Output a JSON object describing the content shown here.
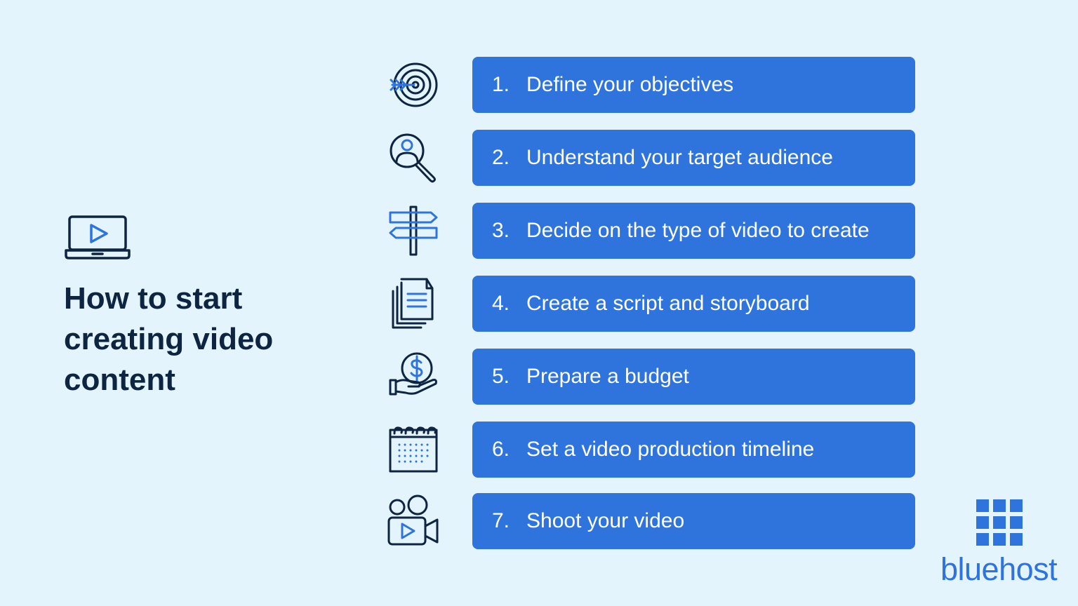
{
  "title_lines": [
    "How to start",
    "creating video",
    "content"
  ],
  "steps": [
    {
      "number": "1.",
      "label": "Define your objectives",
      "icon": "target-icon"
    },
    {
      "number": "2.",
      "label": "Understand your target audience",
      "icon": "audience-search-icon"
    },
    {
      "number": "3.",
      "label": "Decide on the type of video to create",
      "icon": "signpost-icon"
    },
    {
      "number": "4.",
      "label": "Create a script and storyboard",
      "icon": "documents-icon"
    },
    {
      "number": "5.",
      "label": "Prepare a budget",
      "icon": "budget-hand-icon"
    },
    {
      "number": "6.",
      "label": "Set a video production timeline",
      "icon": "calendar-icon"
    },
    {
      "number": "7.",
      "label": "Shoot your video",
      "icon": "video-camera-icon"
    }
  ],
  "brand": {
    "name": "bluehost",
    "logo_icon": "bluehost-grid-icon"
  },
  "colors": {
    "background": "#e4f4fd",
    "bar": "#2f74dd",
    "bar_text": "#ffffff",
    "title": "#0d2540",
    "icon_dark": "#0d2540",
    "icon_accent": "#2f74dd"
  }
}
